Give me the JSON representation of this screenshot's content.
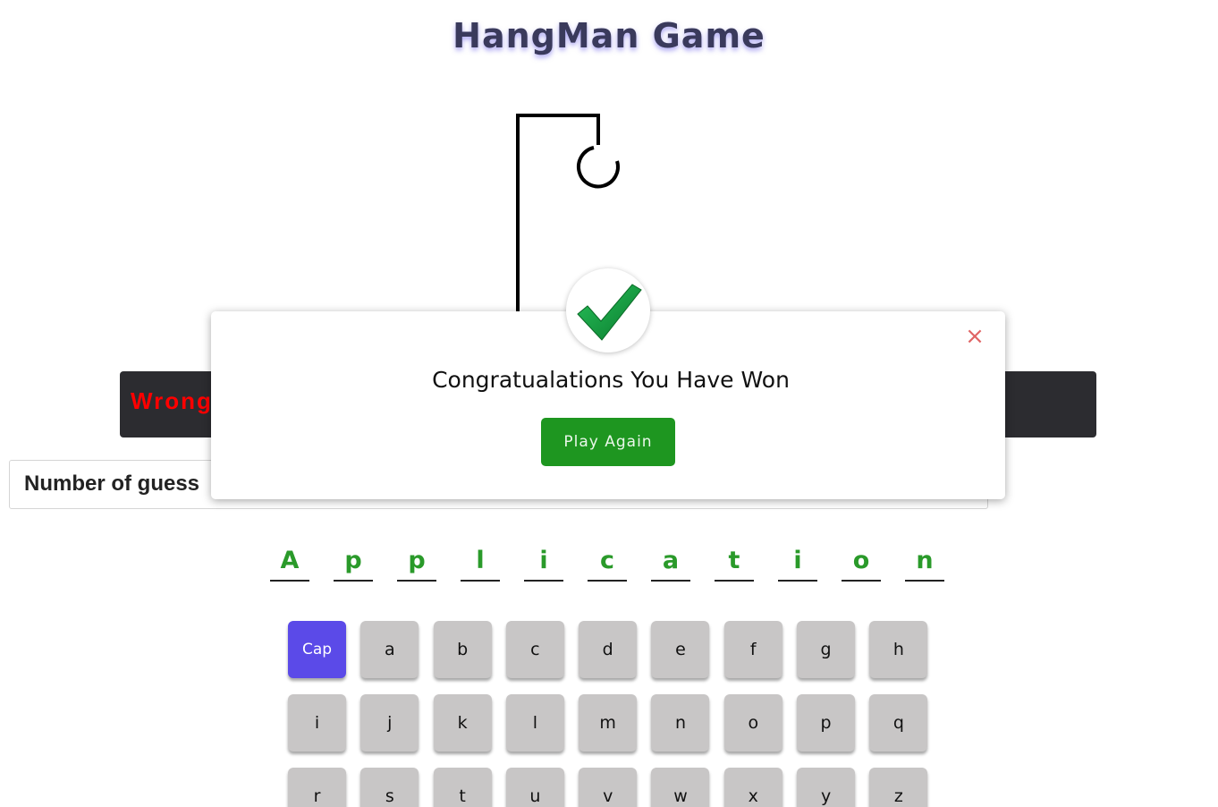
{
  "title": "HangMan Game",
  "status": {
    "wrong_label": "Wrong",
    "guess_label": "Number of guess"
  },
  "word": {
    "letters": [
      "A",
      "p",
      "p",
      "l",
      "i",
      "c",
      "a",
      "t",
      "i",
      "o",
      "n"
    ]
  },
  "keyboard": {
    "keys": [
      "Cap",
      "a",
      "b",
      "c",
      "d",
      "e",
      "f",
      "g",
      "h",
      "i",
      "j",
      "k",
      "l",
      "m",
      "n",
      "o",
      "p",
      "q",
      "r",
      "s",
      "t",
      "u",
      "v",
      "w",
      "x",
      "y",
      "z"
    ]
  },
  "modal": {
    "message": "Congratualations You Have Won",
    "play_again_label": "Play Again",
    "close_symbol": "×",
    "icon": "checkmark-icon"
  },
  "colors": {
    "accent": "#5b4ae8",
    "correct_letter": "#2a9a2a",
    "wrong_text": "#ff0000",
    "play_button": "#1e9620",
    "check_green": "#0f9d3a"
  }
}
